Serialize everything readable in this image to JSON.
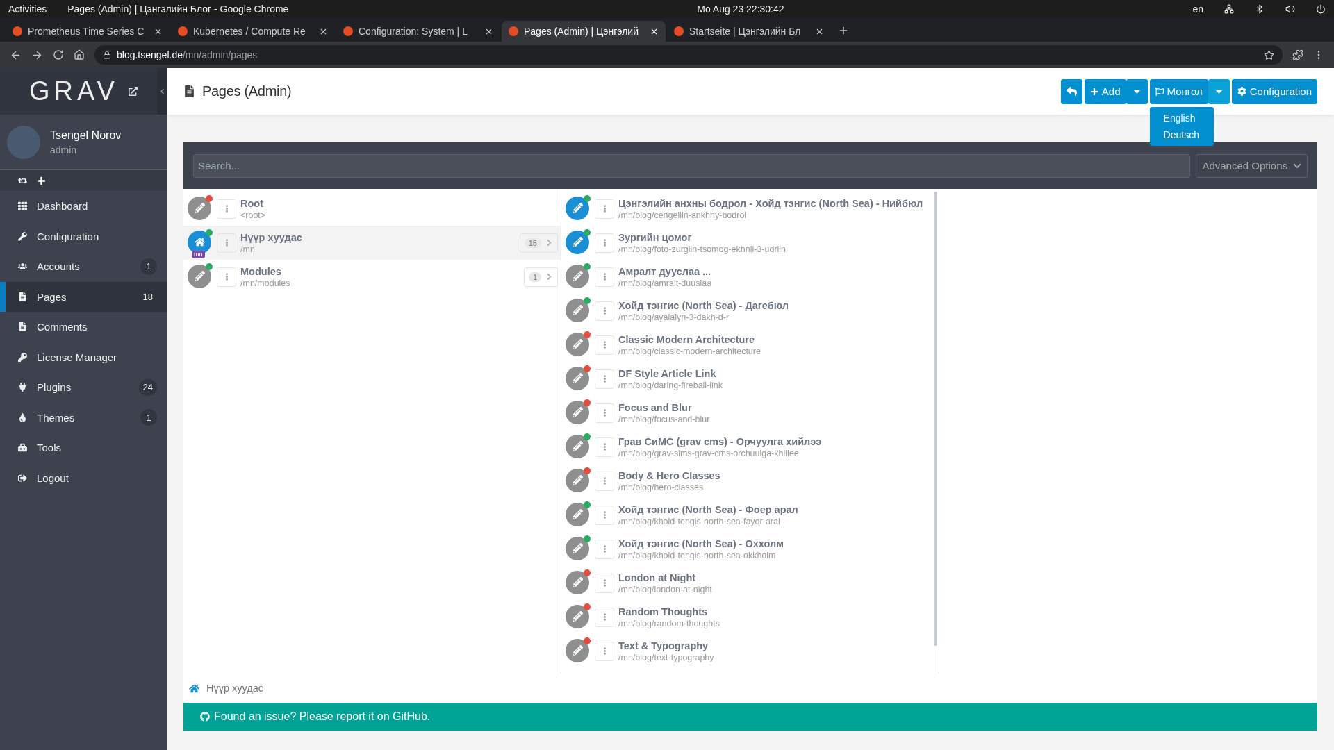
{
  "system_bar": {
    "activities": "Activities",
    "app_title": "Pages (Admin) | Цэнгэлийн Блог - Google Chrome",
    "clock": "Mo Aug 23  22:30:42",
    "keyboard": "en"
  },
  "browser": {
    "tabs": [
      {
        "title": "Prometheus Time Series C",
        "selected": false
      },
      {
        "title": "Kubernetes / Compute Re",
        "selected": false
      },
      {
        "title": "Configuration: System | L",
        "selected": false
      },
      {
        "title": "Pages (Admin) | Цэнгэлий",
        "selected": true
      },
      {
        "title": "Startseite | Цэнгэлийн Бл",
        "selected": false
      }
    ],
    "url_host": "blog.tsengel.de",
    "url_path": "/mn/admin/pages"
  },
  "sidebar": {
    "logo": "GRAV",
    "user": {
      "name": "Tsengel Norov",
      "role": "admin"
    },
    "items": [
      {
        "label": "Dashboard",
        "selected": false
      },
      {
        "label": "Configuration",
        "selected": false
      },
      {
        "label": "Accounts",
        "count": "1",
        "selected": false
      },
      {
        "label": "Pages",
        "count": "18",
        "selected": true
      },
      {
        "label": "Comments",
        "selected": false
      },
      {
        "label": "License Manager",
        "selected": false
      },
      {
        "label": "Plugins",
        "count": "24",
        "selected": false
      },
      {
        "label": "Themes",
        "count": "1",
        "selected": false
      },
      {
        "label": "Tools",
        "selected": false
      },
      {
        "label": "Logout",
        "selected": false
      }
    ]
  },
  "header": {
    "title": "Pages (Admin)",
    "add_label": "Add",
    "language_label": "Монгол",
    "configuration_label": "Configuration",
    "language_menu": [
      "English",
      "Deutsch"
    ]
  },
  "filter": {
    "placeholder": "Search...",
    "advanced_label": "Advanced Options"
  },
  "left_pages": [
    {
      "kind": "page",
      "title": "Root",
      "path": "<root>",
      "color": "#e74c3c",
      "highlighted": false,
      "selected": false
    },
    {
      "kind": "home",
      "title": "Нүүр хуудас",
      "path": "/mn",
      "color": "#27ae60",
      "highlighted": true,
      "selected": true,
      "lang_badge": "mn",
      "children_count": "15"
    },
    {
      "kind": "page",
      "title": "Modules",
      "path": "/mn/modules",
      "color": "#27ae60",
      "highlighted": false,
      "selected": false,
      "children_count": "1"
    }
  ],
  "right_pages": [
    {
      "kind": "page",
      "title": "Цэнгэлийн анхны бодрол - Хойд тэнгис (North Sea) - Нийбюл",
      "path": "/mn/blog/cengeliin-ankhny-bodrol",
      "color": "#27ae60",
      "highlighted": true
    },
    {
      "kind": "page",
      "title": "Зургийн цомог",
      "path": "/mn/blog/foto-zurgiin-tsomog-ekhnii-3-udriin",
      "color": "#27ae60",
      "highlighted": true
    },
    {
      "kind": "page",
      "title": "Амралт дууслаа ...",
      "path": "/mn/blog/amralt-duuslaa",
      "color": "#27ae60",
      "highlighted": false
    },
    {
      "kind": "page",
      "title": "Хойд тэнгис (North Sea) - Дагебюл",
      "path": "/mn/blog/ayalalyn-3-dakh-d-r",
      "color": "#27ae60",
      "highlighted": false
    },
    {
      "kind": "page",
      "title": "Classic Modern Architecture",
      "path": "/mn/blog/classic-modern-architecture",
      "color": "#e74c3c",
      "highlighted": false
    },
    {
      "kind": "page",
      "title": "DF Style Article Link",
      "path": "/mn/blog/daring-fireball-link",
      "color": "#e74c3c",
      "highlighted": false
    },
    {
      "kind": "page",
      "title": "Focus and Blur",
      "path": "/mn/blog/focus-and-blur",
      "color": "#e74c3c",
      "highlighted": false
    },
    {
      "kind": "page",
      "title": "Грав СиМС (grav cms) - Орчуулга хийлээ",
      "path": "/mn/blog/grav-sims-grav-cms-orchuulga-khiilee",
      "color": "#27ae60",
      "highlighted": false
    },
    {
      "kind": "page",
      "title": "Body & Hero Classes",
      "path": "/mn/blog/hero-classes",
      "color": "#e74c3c",
      "highlighted": false
    },
    {
      "kind": "page",
      "title": "Хойд тэнгис (North Sea) - Фоер арал",
      "path": "/mn/blog/khoid-tengis-north-sea-fayor-aral",
      "color": "#27ae60",
      "highlighted": false
    },
    {
      "kind": "page",
      "title": "Хойд тэнгис (North Sea) - Оххолм",
      "path": "/mn/blog/khoid-tengis-north-sea-okkholm",
      "color": "#27ae60",
      "highlighted": false
    },
    {
      "kind": "page",
      "title": "London at Night",
      "path": "/mn/blog/london-at-night",
      "color": "#e74c3c",
      "highlighted": false
    },
    {
      "kind": "page",
      "title": "Random Thoughts",
      "path": "/mn/blog/random-thoughts",
      "color": "#e74c3c",
      "highlighted": false
    },
    {
      "kind": "page",
      "title": "Text & Typography",
      "path": "/mn/blog/text-typography",
      "color": "#e74c3c",
      "highlighted": false
    }
  ],
  "breadcrumb": "Нүүр хуудас",
  "footer": "Found an issue? Please report it on GitHub."
}
